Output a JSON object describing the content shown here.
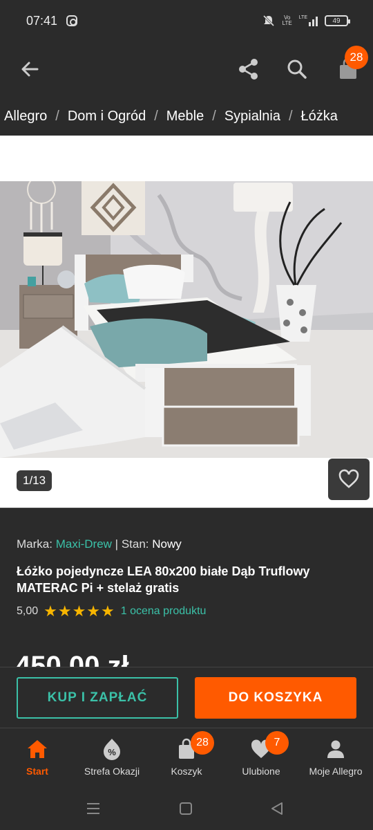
{
  "status_bar": {
    "time": "07:41",
    "network1": "Vo LTE",
    "network2": "LTE",
    "battery": "49"
  },
  "app_bar": {
    "cart_count": "28"
  },
  "breadcrumb": {
    "items": [
      "Allegro",
      "Dom i Ogród",
      "Meble",
      "Sypialnia",
      "Łóżka"
    ]
  },
  "gallery": {
    "counter": "1/13"
  },
  "product": {
    "brand_label": "Marka:",
    "brand": "Maxi-Drew",
    "separator": "|",
    "condition_label": "Stan:",
    "condition": "Nowy",
    "title": "Łóżko pojedyncze LEA 80x200 białe Dąb Truflowy MATERAC Pi + stelaż gratis",
    "rating_value": "5,00",
    "stars": 5,
    "rating_link": "1 ocena produktu",
    "price_partial": "450,00 zł"
  },
  "actions": {
    "buy_label": "KUP I ZAPŁAĆ",
    "cart_label": "DO KOSZYKA"
  },
  "bottom_nav": {
    "items": [
      {
        "label": "Start",
        "icon": "home-icon"
      },
      {
        "label": "Strefa Okazji",
        "icon": "discount-icon"
      },
      {
        "label": "Koszyk",
        "icon": "bag-icon",
        "badge": "28"
      },
      {
        "label": "Ulubione",
        "icon": "heart-icon",
        "badge": "7"
      },
      {
        "label": "Moje Allegro",
        "icon": "person-icon"
      }
    ]
  },
  "colors": {
    "accent_orange": "#ff5a00",
    "accent_teal": "#3bc1a8",
    "star": "#f7b500",
    "background": "#2b2b2b"
  }
}
